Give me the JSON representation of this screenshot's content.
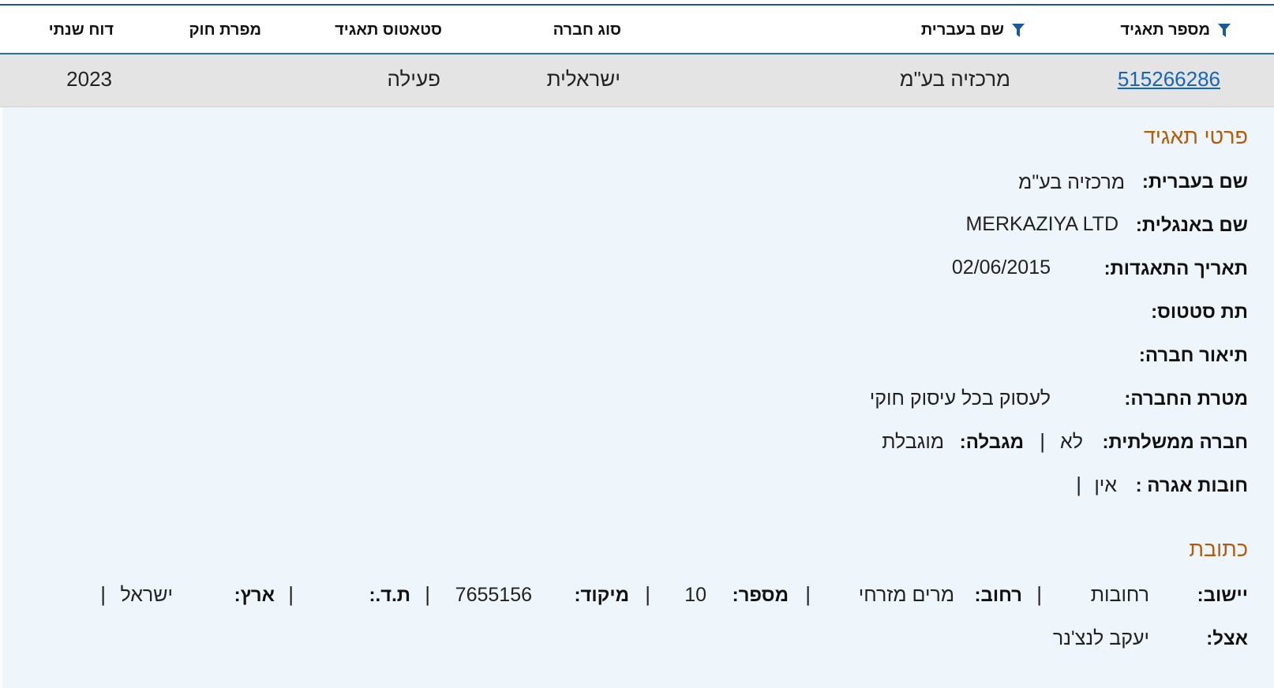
{
  "table": {
    "headers": {
      "corp_number": "מספר תאגיד",
      "hebrew_name": "שם בעברית",
      "company_type": "סוג חברה",
      "corp_status": "סטאטוס תאגיד",
      "law_violator": "מפרת חוק",
      "annual_report": "דוח שנתי"
    },
    "row": {
      "corp_number": "515266286",
      "hebrew_name": "מרכזיה בע\"מ",
      "company_type": "ישראלית",
      "corp_status": "פעילה",
      "law_violator": "",
      "annual_report": "2023"
    }
  },
  "details": {
    "title": "פרטי תאגיד",
    "hebrew_name_label": "שם בעברית:",
    "hebrew_name_value": "מרכזיה בע\"מ",
    "english_name_label": "שם באנגלית:",
    "english_name_value": "MERKAZIYA LTD",
    "incorporation_date_label": "תאריך התאגדות:",
    "incorporation_date_value": "02/06/2015",
    "sub_status_label": "תת סטטוס:",
    "company_description_label": "תיאור חברה:",
    "company_purpose_label": "מטרת החברה:",
    "company_purpose_value": "לעסוק בכל עיסוק חוקי",
    "government_company_label": "חברה ממשלתית:",
    "government_company_value": "לא",
    "limited_label": "מגבלה:",
    "limited_value": "מוגבלת",
    "fee_debts_label": "חובות אגרה :",
    "fee_debts_value": "אין",
    "separator": "|"
  },
  "address": {
    "title": "כתובת",
    "city_label": "יישוב:",
    "city_value": "רחובות",
    "street_label": "רחוב:",
    "street_value": "מרים מזרחי",
    "number_label": "מספר:",
    "number_value": "10",
    "zip_label": "מיקוד:",
    "zip_value": "7655156",
    "pobox_label": "ת.ד.:",
    "pobox_value": "",
    "country_label": "ארץ:",
    "country_value": "ישראל",
    "care_of_label": "אצל:",
    "care_of_value": "יעקב לנצ'נר"
  },
  "icons": {
    "filter": "filter-icon"
  },
  "colors": {
    "link": "#1565c0",
    "section_title": "#b35d0c",
    "header_border": "#2f6cab",
    "row_bg": "#e4e4e4",
    "panel_bg": "#eef5fb"
  }
}
